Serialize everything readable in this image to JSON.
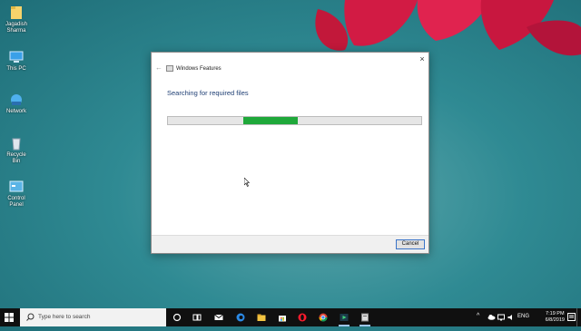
{
  "desktop": {
    "icons": [
      {
        "name": "user-folder-icon",
        "label_line1": "Jagadish",
        "label_line2": "Sharma"
      },
      {
        "name": "this-pc-icon",
        "label_line1": "This PC",
        "label_line2": ""
      },
      {
        "name": "network-icon",
        "label_line1": "Network",
        "label_line2": ""
      },
      {
        "name": "recycle-bin-icon",
        "label_line1": "Recycle Bin",
        "label_line2": ""
      },
      {
        "name": "control-panel-icon",
        "label_line1": "Control",
        "label_line2": "Panel"
      }
    ]
  },
  "dialog": {
    "title": "Windows Features",
    "close_label": "×",
    "back_label": "←",
    "heading": "Searching for required files",
    "progress": {
      "state": "indeterminate",
      "fill_color": "#1fa83a"
    },
    "cancel_label": "Cancel"
  },
  "taskbar": {
    "search_placeholder": "Type here to search",
    "apps": [
      "cortana-icon",
      "task-view-icon",
      "mail-icon",
      "edge-icon",
      "file-explorer-icon",
      "store-icon",
      "opera-icon",
      "chrome-icon",
      "media-player-icon",
      "windows-features-icon"
    ],
    "tray": {
      "chevron": "^",
      "language": "ENG",
      "time": "7:19 PM",
      "date": "6/8/2019"
    }
  },
  "colors": {
    "accent": "#3a74c9",
    "heading": "#1f3f74",
    "progress": "#1fa83a"
  }
}
